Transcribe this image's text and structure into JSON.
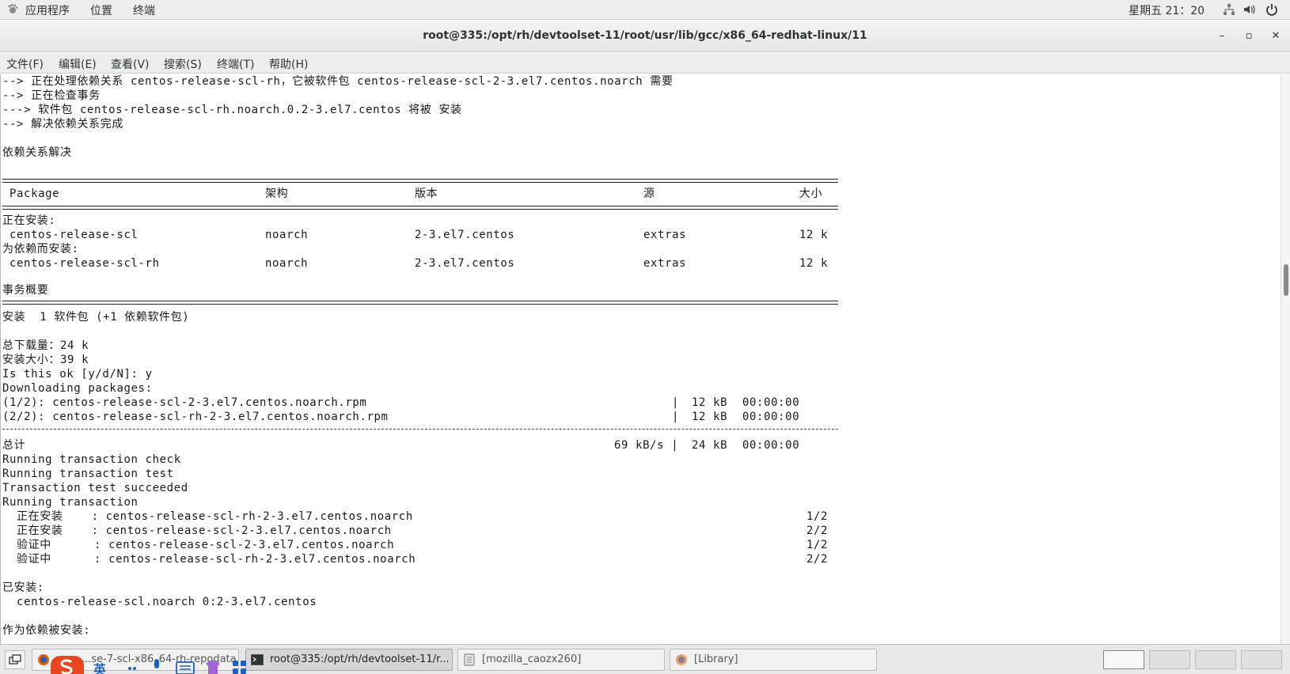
{
  "top_panel": {
    "apps": "应用程序",
    "places": "位置",
    "terminal": "终端",
    "clock": "星期五 21：20"
  },
  "window": {
    "title": "root@335:/opt/rh/devtoolset-11/root/usr/lib/gcc/x86_64-redhat-linux/11",
    "minimize": "–",
    "maximize": "▫",
    "close": "✕"
  },
  "menu": [
    "文件(F)",
    "编辑(E)",
    "查看(V)",
    "搜索(S)",
    "终端(T)",
    "帮助(H)"
  ],
  "terminal": {
    "lines_top": [
      "--> 正在处理依赖关系 centos-release-scl-rh，它被软件包 centos-release-scl-2-3.el7.centos.noarch 需要",
      "--> 正在检查事务",
      "---> 软件包 centos-release-scl-rh.noarch.0.2-3.el7.centos 将被 安装",
      "--> 解决依赖关系完成",
      "",
      "依赖关系解决"
    ],
    "table_header": {
      "package": "Package",
      "arch": "架构",
      "version": "版本",
      "repo": "源",
      "size": "大小"
    },
    "installing_label": "正在安装:",
    "dep_label": "为依赖而安装:",
    "rows": [
      {
        "package": "centos-release-scl",
        "arch": "noarch",
        "version": "2-3.el7.centos",
        "repo": "extras",
        "size": "12 k"
      },
      {
        "package": "centos-release-scl-rh",
        "arch": "noarch",
        "version": "2-3.el7.centos",
        "repo": "extras",
        "size": "12 k"
      }
    ],
    "summary_label": "事务概要",
    "install_summary": "安装  1 软件包 (+1 依赖软件包)",
    "total_download": "总下载量：24 k",
    "installed_size": "安装大小：39 k",
    "prompt": "Is this ok [y/d/N]: y",
    "downloading": "Downloading packages:",
    "downloads": [
      {
        "name": "(1/2): centos-release-scl-2-3.el7.centos.noarch.rpm",
        "sep": "|",
        "size": "12 kB",
        "time": "00:00:00"
      },
      {
        "name": "(2/2): centos-release-scl-rh-2-3.el7.centos.noarch.rpm",
        "sep": "|",
        "size": "12 kB",
        "time": "00:00:00"
      }
    ],
    "total": {
      "label": "总计",
      "speed": "69 kB/s |",
      "size": "24 kB",
      "time": "00:00:00"
    },
    "transaction_lines": [
      "Running transaction check",
      "Running transaction test",
      "Transaction test succeeded",
      "Running transaction"
    ],
    "steps": [
      {
        "action": "  正在安装    : centos-release-scl-rh-2-3.el7.centos.noarch",
        "progress": "1/2"
      },
      {
        "action": "  正在安装    : centos-release-scl-2-3.el7.centos.noarch",
        "progress": "2/2"
      },
      {
        "action": "  验证中      : centos-release-scl-2-3.el7.centos.noarch",
        "progress": "1/2"
      },
      {
        "action": "  验证中      : centos-release-scl-rh-2-3.el7.centos.noarch",
        "progress": "2/2"
      }
    ],
    "installed_label": "已安装:",
    "installed_item": "  centos-release-scl.noarch 0:2-3.el7.centos",
    "dep_installed_label": "作为依赖被安装:"
  },
  "taskbar": {
    "tasks": [
      {
        "label": "...se-7-scl-x86_64-rh-repodata",
        "icon": "firefox-icon"
      },
      {
        "label": "root@335:/opt/rh/devtoolset-11/r...",
        "icon": "terminal-icon"
      },
      {
        "label": "[mozilla_caozx260]",
        "icon": "file-manager-icon"
      },
      {
        "label": "[Library]",
        "icon": "firefox-icon"
      }
    ],
    "ime_text": "英"
  },
  "colors": {
    "panel_bg": "#ededed",
    "terminal_bg": "#ffffff",
    "text": "#1a1a1a",
    "ime_red": "#e8461f"
  }
}
